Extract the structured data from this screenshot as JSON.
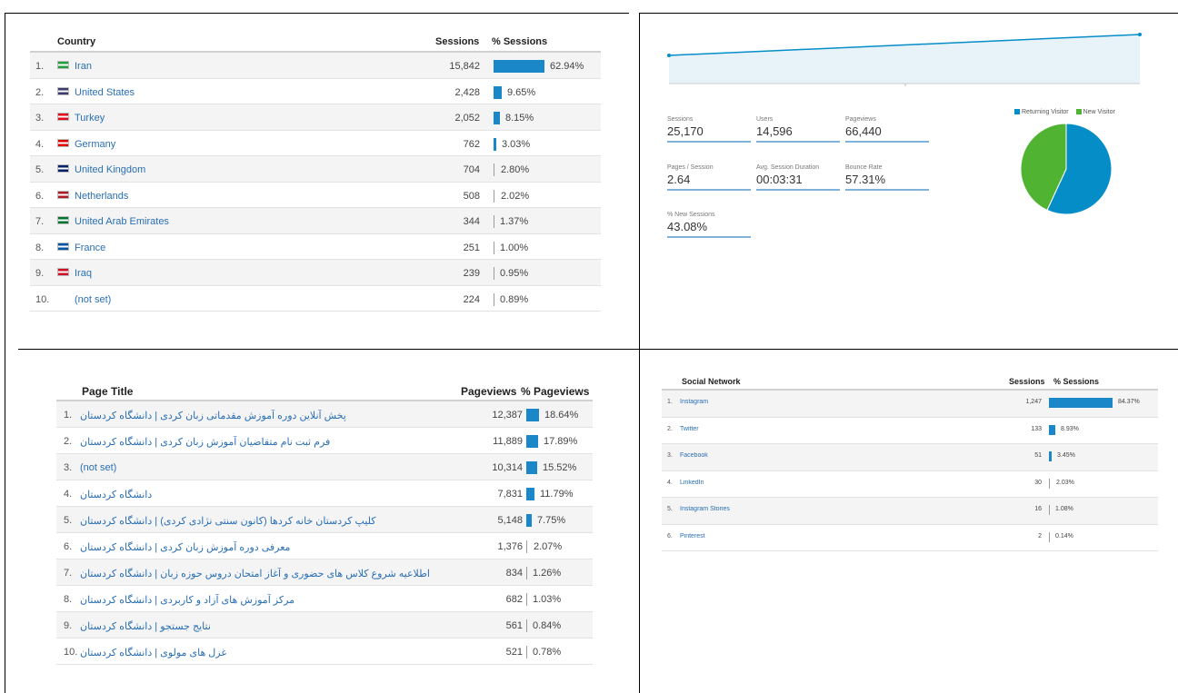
{
  "country_table": {
    "headers": {
      "dimension": "Country",
      "metric": "Sessions",
      "percent": "% Sessions"
    },
    "rows": [
      {
        "idx": "1.",
        "label": "Iran",
        "value": "15,842",
        "pct": "62.94%",
        "share": 62.94,
        "flag_color": "#239f40"
      },
      {
        "idx": "2.",
        "label": "United States",
        "value": "2,428",
        "pct": "9.65%",
        "share": 9.65,
        "flag_color": "#3c3b6e"
      },
      {
        "idx": "3.",
        "label": "Turkey",
        "value": "2,052",
        "pct": "8.15%",
        "share": 8.15,
        "flag_color": "#e30a17"
      },
      {
        "idx": "4.",
        "label": "Germany",
        "value": "762",
        "pct": "3.03%",
        "share": 3.03,
        "flag_color": "#dd0000"
      },
      {
        "idx": "5.",
        "label": "United Kingdom",
        "value": "704",
        "pct": "2.80%",
        "share": 2.8,
        "flag_color": "#012169"
      },
      {
        "idx": "6.",
        "label": "Netherlands",
        "value": "508",
        "pct": "2.02%",
        "share": 2.02,
        "flag_color": "#ae1c28"
      },
      {
        "idx": "7.",
        "label": "United Arab Emirates",
        "value": "344",
        "pct": "1.37%",
        "share": 1.37,
        "flag_color": "#00732f"
      },
      {
        "idx": "8.",
        "label": "France",
        "value": "251",
        "pct": "1.00%",
        "share": 1.0,
        "flag_color": "#0055a4"
      },
      {
        "idx": "9.",
        "label": "Iraq",
        "value": "239",
        "pct": "0.95%",
        "share": 0.95,
        "flag_color": "#ce1126"
      },
      {
        "idx": "10.",
        "label": "(not set)",
        "value": "224",
        "pct": "0.89%",
        "share": 0.89,
        "flag_color": ""
      }
    ]
  },
  "overview": {
    "metrics": [
      {
        "label": "Sessions",
        "value": "25,170"
      },
      {
        "label": "Users",
        "value": "14,596"
      },
      {
        "label": "Pageviews",
        "value": "66,440"
      },
      {
        "label": "Pages / Session",
        "value": "2.64"
      },
      {
        "label": "Avg. Session Duration",
        "value": "00:03:31"
      },
      {
        "label": "Bounce Rate",
        "value": "57.31%"
      },
      {
        "label": "% New Sessions",
        "value": "43.08%"
      }
    ],
    "legend": [
      {
        "label": "Returning Visitor",
        "color": "#058dc7"
      },
      {
        "label": "New Visitor",
        "color": "#50b432"
      }
    ],
    "pie_shares": {
      "returning": 56.9,
      "new": 43.1
    },
    "line_colors": {
      "line": "#058dc7",
      "fill": "#e8f2f9"
    }
  },
  "page_table": {
    "headers": {
      "dimension": "Page Title",
      "metric": "Pageviews",
      "percent": "% Pageviews"
    },
    "rows": [
      {
        "idx": "1.",
        "label": "پخش آنلاین دوره آموزش مقدماتی زبان کردی | دانشگاه کردستان",
        "value": "12,387",
        "pct": "18.64%",
        "share": 18.64
      },
      {
        "idx": "2.",
        "label": "فرم ثبت نام متقاضیان آموزش زبان کردی | دانشگاه کردستان",
        "value": "11,889",
        "pct": "17.89%",
        "share": 17.89
      },
      {
        "idx": "3.",
        "label": "(not set)",
        "value": "10,314",
        "pct": "15.52%",
        "share": 15.52
      },
      {
        "idx": "4.",
        "label": "دانشگاه کردستان",
        "value": "7,831",
        "pct": "11.79%",
        "share": 11.79
      },
      {
        "idx": "5.",
        "label": "کلیپ کردستان خانه کردها (کانون سنتی نژادی کردی) | دانشگاه کردستان",
        "value": "5,148",
        "pct": "7.75%",
        "share": 7.75
      },
      {
        "idx": "6.",
        "label": "معرفی دوره آموزش زبان کردی | دانشگاه کردستان",
        "value": "1,376",
        "pct": "2.07%",
        "share": 2.07
      },
      {
        "idx": "7.",
        "label": "اطلاعیه شروع کلاس های حضوری و آغاز امتحان دروس حوزه زبان | دانشگاه کردستان",
        "value": "834",
        "pct": "1.26%",
        "share": 1.26
      },
      {
        "idx": "8.",
        "label": "مرکز آموزش های آزاد و کاربردی | دانشگاه کردستان",
        "value": "682",
        "pct": "1.03%",
        "share": 1.03
      },
      {
        "idx": "9.",
        "label": "نتایج جستجو | دانشگاه کردستان",
        "value": "561",
        "pct": "0.84%",
        "share": 0.84
      },
      {
        "idx": "10.",
        "label": "غزل های مولوی | دانشگاه کردستان",
        "value": "521",
        "pct": "0.78%",
        "share": 0.78
      }
    ]
  },
  "social_table": {
    "headers": {
      "dimension": "Social Network",
      "metric": "Sessions",
      "percent": "% Sessions"
    },
    "rows": [
      {
        "idx": "1.",
        "label": "Instagram",
        "value": "1,247",
        "pct": "84.37%",
        "share": 84.37
      },
      {
        "idx": "2.",
        "label": "Twitter",
        "value": "133",
        "pct": "8.93%",
        "share": 8.93
      },
      {
        "idx": "3.",
        "label": "Facebook",
        "value": "51",
        "pct": "3.45%",
        "share": 3.45
      },
      {
        "idx": "4.",
        "label": "LinkedIn",
        "value": "30",
        "pct": "2.03%",
        "share": 2.03
      },
      {
        "idx": "5.",
        "label": "Instagram Stories",
        "value": "16",
        "pct": "1.08%",
        "share": 1.08
      },
      {
        "idx": "6.",
        "label": "Pinterest",
        "value": "2",
        "pct": "0.14%",
        "share": 0.14
      }
    ]
  }
}
